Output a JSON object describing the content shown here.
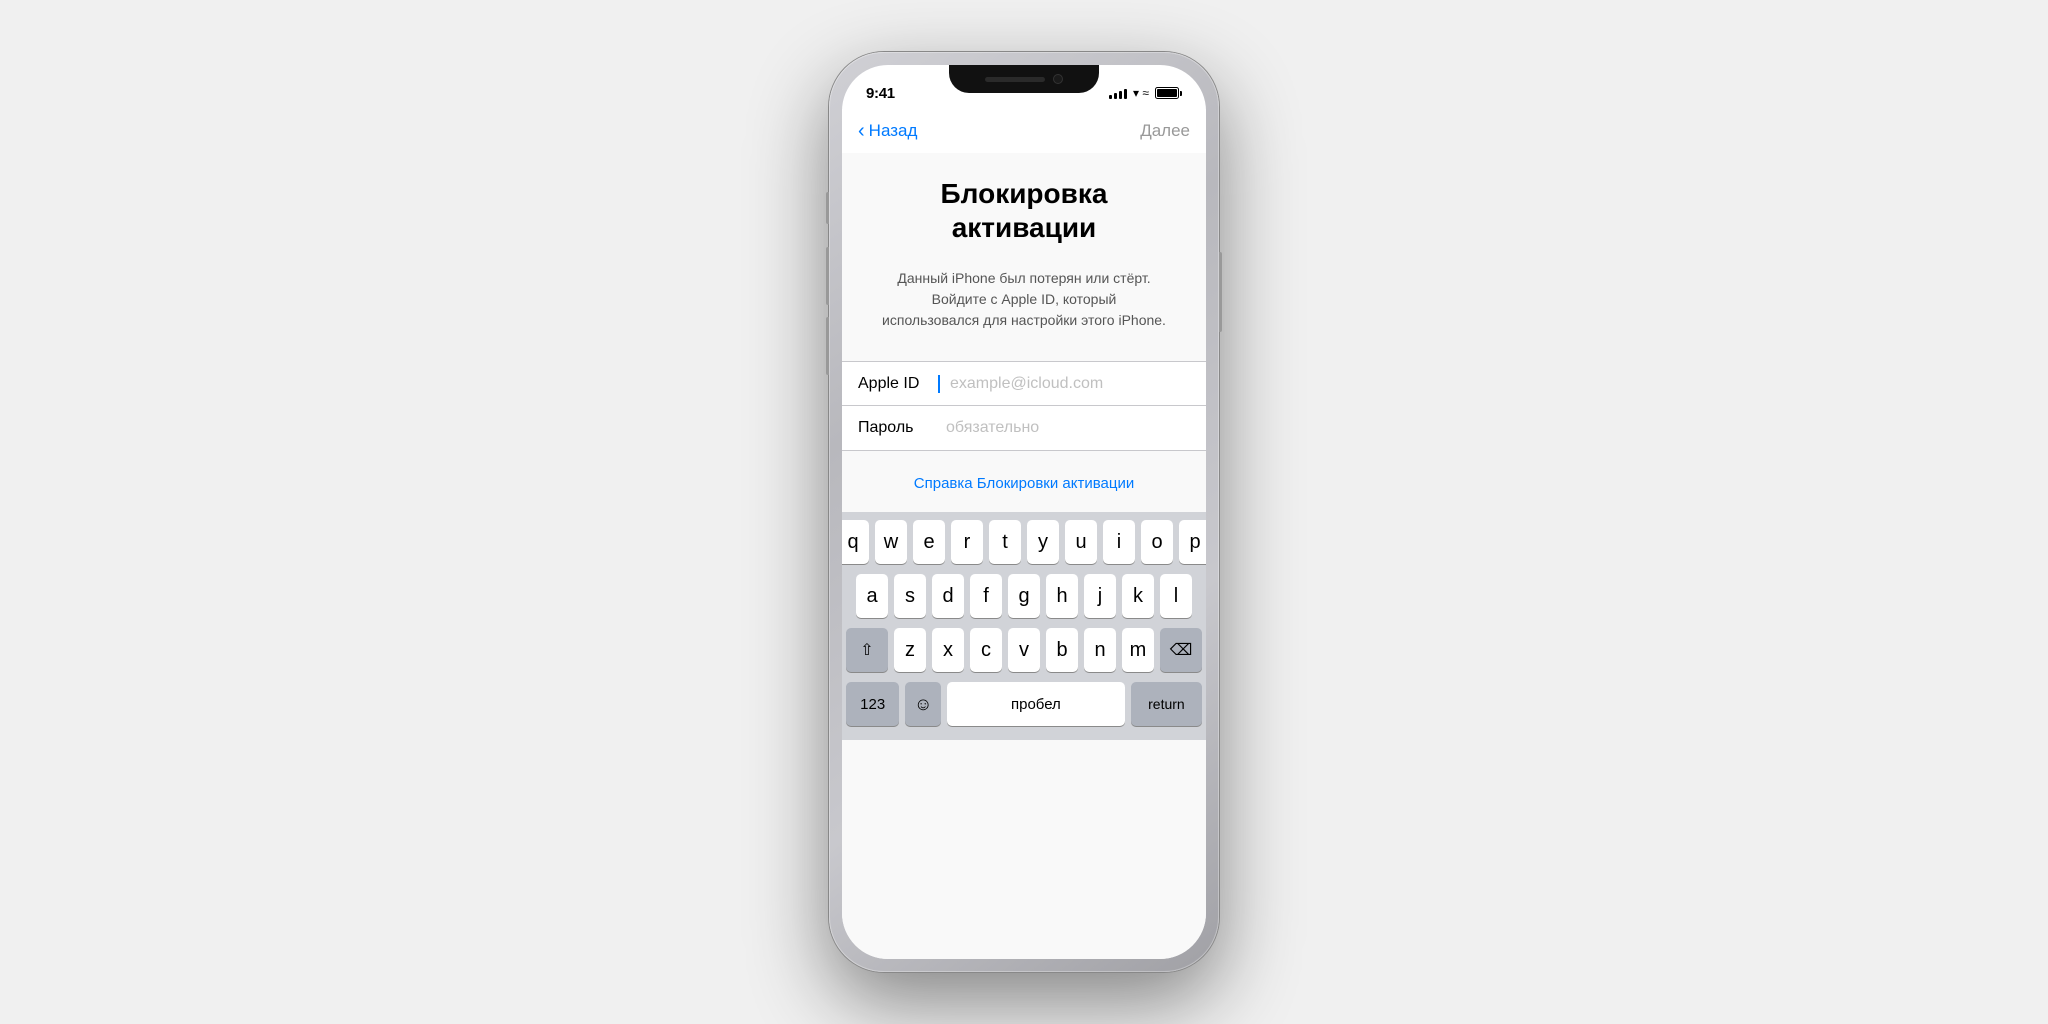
{
  "statusBar": {
    "time": "9:41",
    "signalBars": [
      4,
      6,
      8,
      10,
      12
    ],
    "wifiLabel": "wifi",
    "batteryLabel": "battery"
  },
  "nav": {
    "backLabel": "Назад",
    "nextLabel": "Далее"
  },
  "page": {
    "title": "Блокировка\nактивации",
    "description": "Данный iPhone был потерян или стёрт.\nВойдите с Apple ID, который использовался\nдля настройки этого iPhone."
  },
  "form": {
    "appleIdLabel": "Apple ID",
    "appleIdPlaceholder": "example@icloud.com",
    "passwordLabel": "Пароль",
    "passwordPlaceholder": "обязательно"
  },
  "helpLink": "Справка Блокировки активации",
  "keyboard": {
    "row1": [
      "q",
      "w",
      "e",
      "r",
      "t",
      "y",
      "u",
      "i",
      "o",
      "p"
    ],
    "row2": [
      "a",
      "s",
      "d",
      "f",
      "g",
      "h",
      "j",
      "k",
      "l"
    ],
    "row3": [
      "z",
      "x",
      "c",
      "v",
      "b",
      "n",
      "m"
    ],
    "spaceLabel": "пробел"
  }
}
